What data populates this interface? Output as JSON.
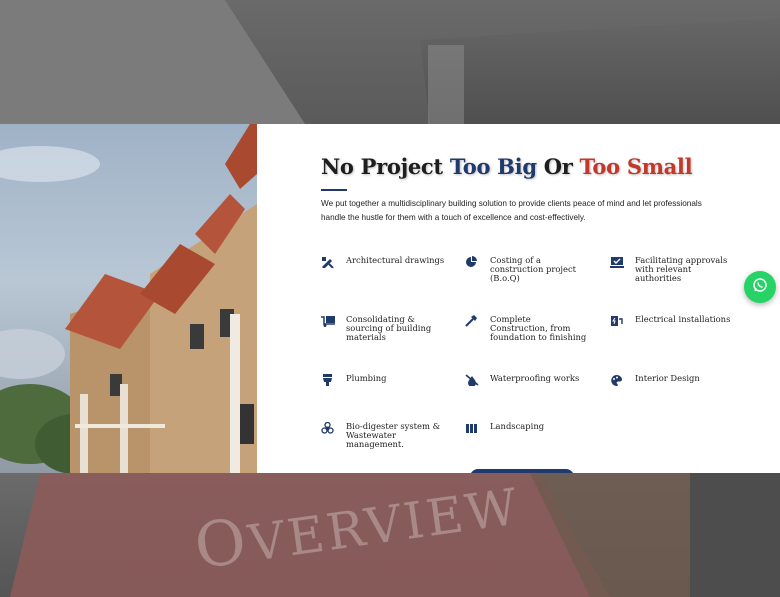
{
  "headline": {
    "part1": "No Project ",
    "part2": "Too Big",
    "part3": " Or ",
    "part4": "Too Small"
  },
  "intro": "We put together a multidisciplinary building solution to provide clients peace of mind and let professionals handle the hustle for them with a touch of excellence and cost-effectively.",
  "services": [
    {
      "label": "Architectural drawings",
      "icon": "pencil-ruler-icon"
    },
    {
      "label": "Costing of a construction project (B.o.Q)",
      "icon": "pie-chart-icon"
    },
    {
      "label": "Facilitating approvals with relevant authorities",
      "icon": "approval-check-icon"
    },
    {
      "label": "Consolidating & sourcing of building materials",
      "icon": "truck-loading-icon"
    },
    {
      "label": "Complete Construction, from foundation to finishing",
      "icon": "hammer-icon"
    },
    {
      "label": "Electrical installations",
      "icon": "charging-station-icon"
    },
    {
      "label": "Plumbing",
      "icon": "toilet-icon"
    },
    {
      "label": "Waterproofing works",
      "icon": "no-water-icon"
    },
    {
      "label": "Interior Design",
      "icon": "palette-icon"
    },
    {
      "label": "Bio-digester system & Wastewater management.",
      "icon": "biohazard-icon"
    },
    {
      "label": "Landscaping",
      "icon": "book-open-icon"
    }
  ],
  "overview_heading": {
    "cap": "O",
    "rest": "VERVIEW"
  },
  "colors": {
    "navy": "#1f3a6b",
    "red": "#c0392b",
    "whatsapp": "#25d366"
  }
}
